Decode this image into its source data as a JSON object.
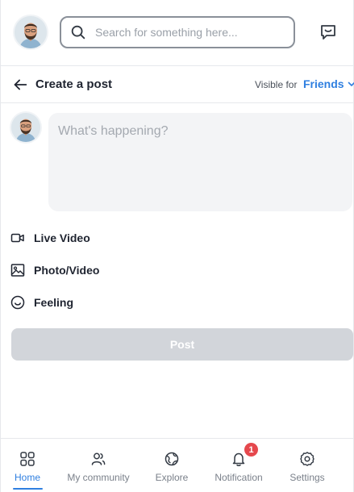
{
  "header": {
    "search": {
      "placeholder": "Search for something here...",
      "value": ""
    }
  },
  "title_row": {
    "title": "Create a post",
    "visible_label": "Visible for",
    "visibility": "Friends"
  },
  "composer": {
    "placeholder": "What's happening?",
    "value": ""
  },
  "options": [
    {
      "label": "Live Video",
      "icon": "video-icon"
    },
    {
      "label": "Photo/Video",
      "icon": "image-icon"
    },
    {
      "label": "Feeling",
      "icon": "smile-icon"
    }
  ],
  "post_button": {
    "label": "Post"
  },
  "bottom_nav": {
    "items": [
      {
        "label": "Home",
        "icon": "grid-icon",
        "active": true
      },
      {
        "label": "My community",
        "icon": "users-icon"
      },
      {
        "label": "Explore",
        "icon": "globe-icon"
      },
      {
        "label": "Notification",
        "icon": "bell-icon",
        "badge": "1"
      },
      {
        "label": "Settings",
        "icon": "gear-icon"
      }
    ]
  },
  "colors": {
    "accent": "#2f7fe0",
    "badge": "#e5484d",
    "post_button_disabled": "#d2d5da",
    "composer_bg": "#f3f4f6"
  }
}
